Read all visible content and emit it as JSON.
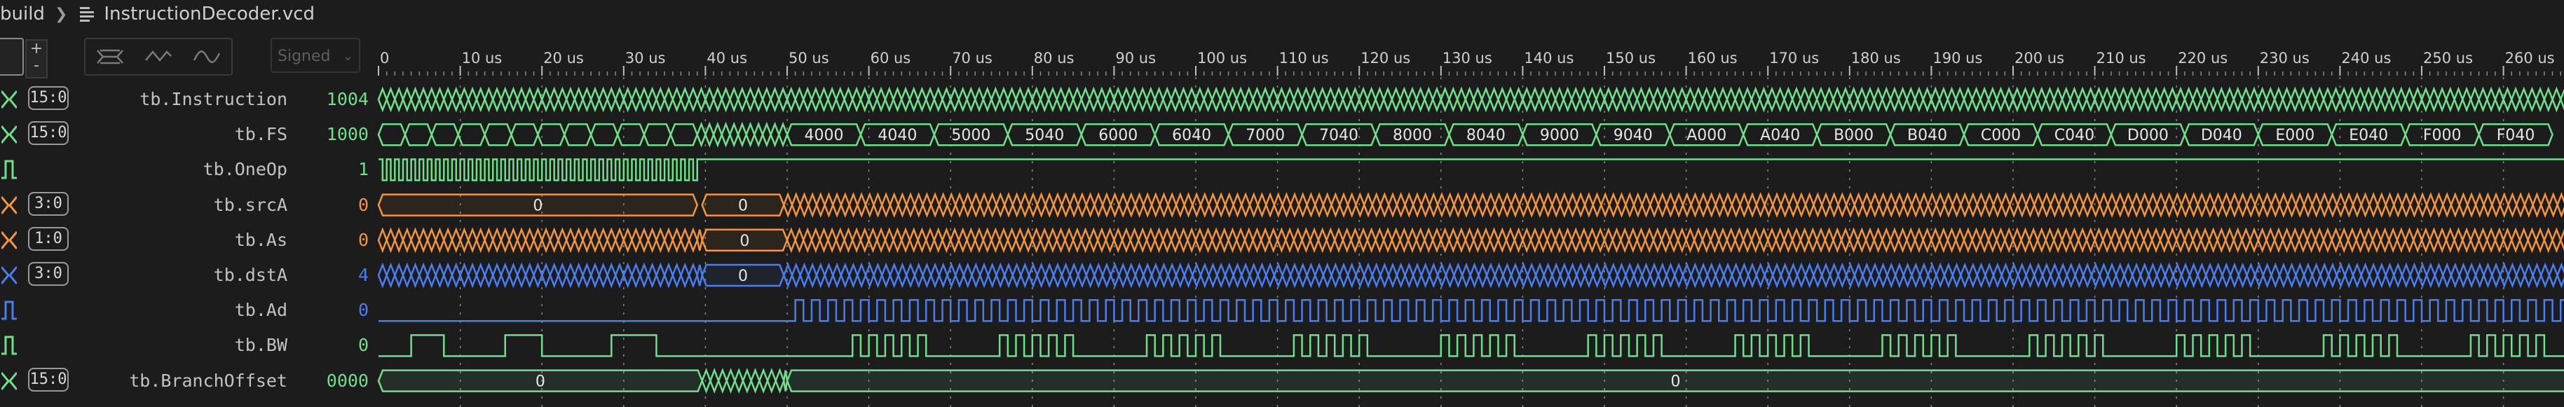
{
  "breadcrumb": {
    "folder": "build",
    "file": "InstructionDecoder.vcd"
  },
  "toolbar": {
    "value_format": "Signed",
    "stepper_up": "+",
    "stepper_down": "-"
  },
  "timeline": {
    "unit": "us",
    "tick_labels": [
      "0",
      "10 us",
      "20 us",
      "30 us",
      "40 us",
      "50 us",
      "60 us",
      "70 us",
      "80 us",
      "90 us",
      "100 us",
      "110 us",
      "120 us",
      "130 us",
      "140 us",
      "150 us",
      "160 us",
      "170 us",
      "180 us",
      "190 us",
      "200 us",
      "210 us",
      "220 us",
      "230 us",
      "240 us",
      "250 us",
      "260 us"
    ]
  },
  "colors": {
    "green": "#6fe08a",
    "orange": "#f5953a",
    "blue": "#4a7df0",
    "grid": "#8a8a8a",
    "bg": "#1c1c1c"
  },
  "signals": [
    {
      "name": "tb.Instruction",
      "range": "15:0",
      "value": "1004",
      "color": "#6fe08a",
      "kind": "bus"
    },
    {
      "name": "tb.FS",
      "range": "15:0",
      "value": "1000",
      "color": "#6fe08a",
      "kind": "bus",
      "segment_labels": [
        "4000",
        "4040",
        "5000",
        "5040",
        "6000",
        "6040",
        "7000",
        "7040",
        "8000",
        "8040",
        "9000",
        "9040",
        "A000",
        "A040",
        "B000",
        "B040",
        "C000",
        "C040",
        "D000",
        "D040",
        "E000",
        "E040",
        "F000",
        "F040"
      ]
    },
    {
      "name": "tb.OneOp",
      "range": "",
      "value": "1",
      "color": "#6fe08a",
      "kind": "bit"
    },
    {
      "name": "tb.srcA",
      "range": "3:0",
      "value": "0",
      "color": "#f5953a",
      "kind": "bus",
      "segment_labels": [
        "0",
        "0"
      ]
    },
    {
      "name": "tb.As",
      "range": "1:0",
      "value": "0",
      "color": "#f5953a",
      "kind": "bus",
      "segment_labels": [
        "0"
      ]
    },
    {
      "name": "tb.dstA",
      "range": "3:0",
      "value": "4",
      "color": "#4a7df0",
      "kind": "bus",
      "segment_labels": [
        "0"
      ]
    },
    {
      "name": "tb.Ad",
      "range": "",
      "value": "0",
      "color": "#4a7df0",
      "kind": "bit"
    },
    {
      "name": "tb.BW",
      "range": "",
      "value": "0",
      "color": "#6fe08a",
      "kind": "bit"
    },
    {
      "name": "tb.BranchOffset",
      "range": "15:0",
      "value": "0000",
      "color": "#6fe08a",
      "kind": "bus",
      "segment_labels": [
        "0",
        "0"
      ]
    }
  ]
}
